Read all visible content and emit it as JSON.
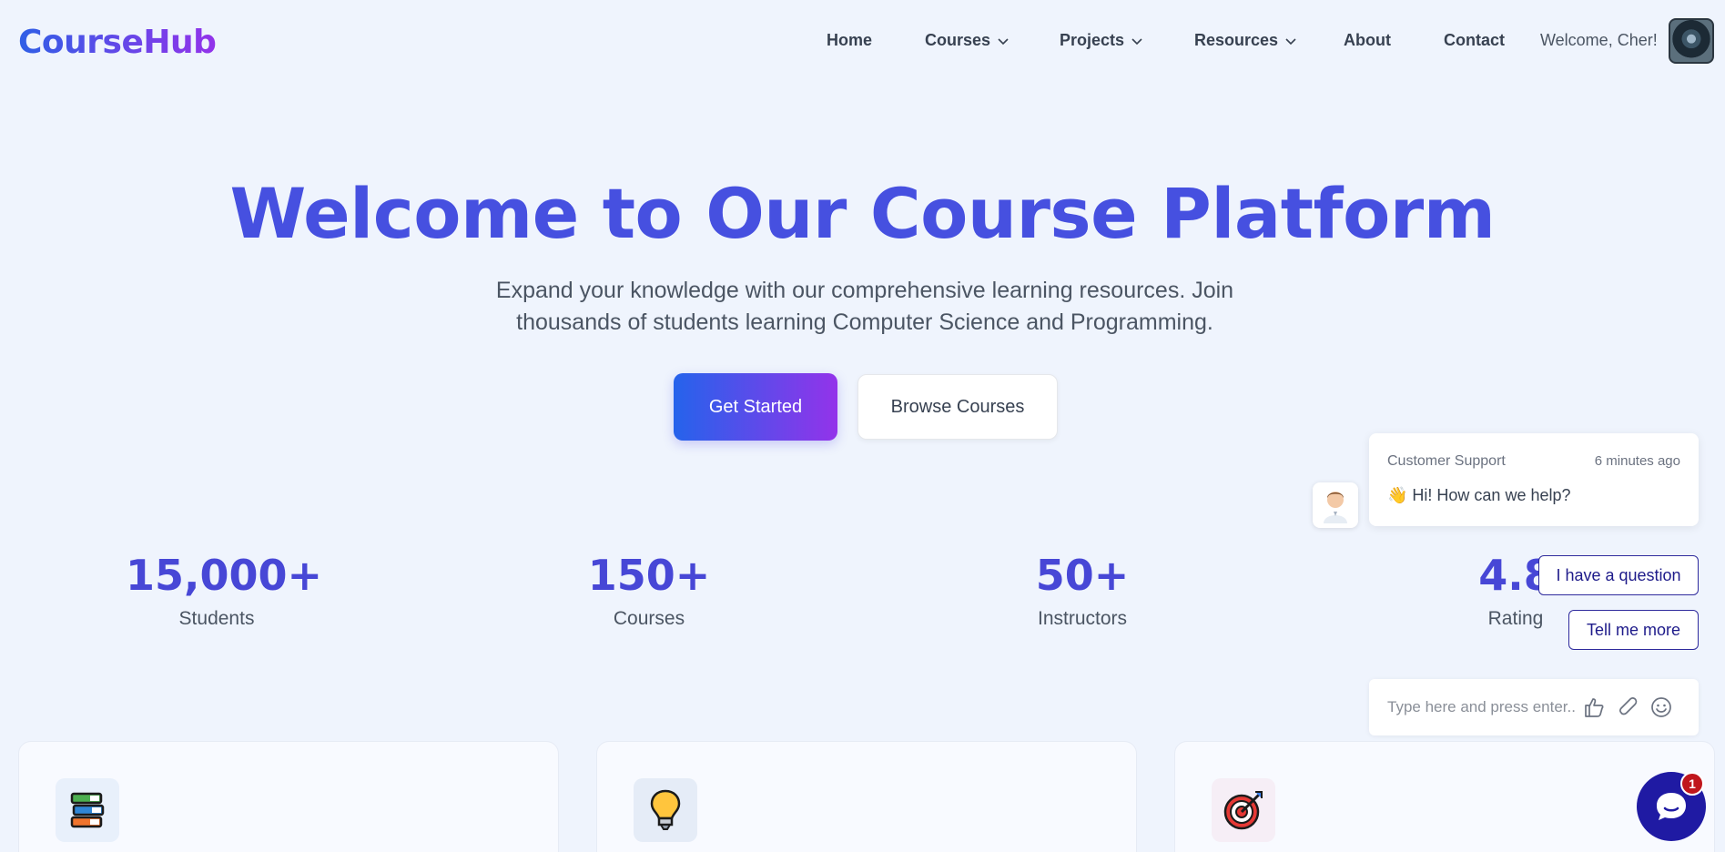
{
  "brand": {
    "logo": "CourseHub"
  },
  "nav": {
    "items": [
      {
        "label": "Home"
      },
      {
        "label": "Courses"
      },
      {
        "label": "Projects"
      },
      {
        "label": "Resources"
      },
      {
        "label": "About"
      },
      {
        "label": "Contact"
      }
    ],
    "welcome": "Welcome, Cher!"
  },
  "hero": {
    "title": "Welcome to Our Course Platform",
    "subtitle_line1": "Expand your knowledge with our comprehensive learning resources. Join",
    "subtitle_line2": "thousands of students learning Computer Science and Programming.",
    "primary_button": "Get Started",
    "secondary_button": "Browse Courses"
  },
  "stats": [
    {
      "value": "15,000+",
      "label": "Students"
    },
    {
      "value": "150+",
      "label": "Courses"
    },
    {
      "value": "50+",
      "label": "Instructors"
    },
    {
      "value": "4.8",
      "label": "Rating"
    }
  ],
  "cards": [
    {
      "icon": "books-icon"
    },
    {
      "icon": "lightbulb-icon"
    },
    {
      "icon": "target-icon"
    }
  ],
  "chat": {
    "sender": "Customer Support",
    "time": "6 minutes ago",
    "message": "👋 Hi! How can we help?",
    "quick_replies": [
      "I have a question",
      "Tell me more"
    ],
    "input_placeholder": "Type here and press enter..",
    "badge_count": "1"
  },
  "colors": {
    "brand_gradient_start": "#2563eb",
    "brand_gradient_end": "#9333ea",
    "heading": "#4650e0",
    "chat_primary": "#1f1aa3",
    "badge": "#c0161c"
  }
}
